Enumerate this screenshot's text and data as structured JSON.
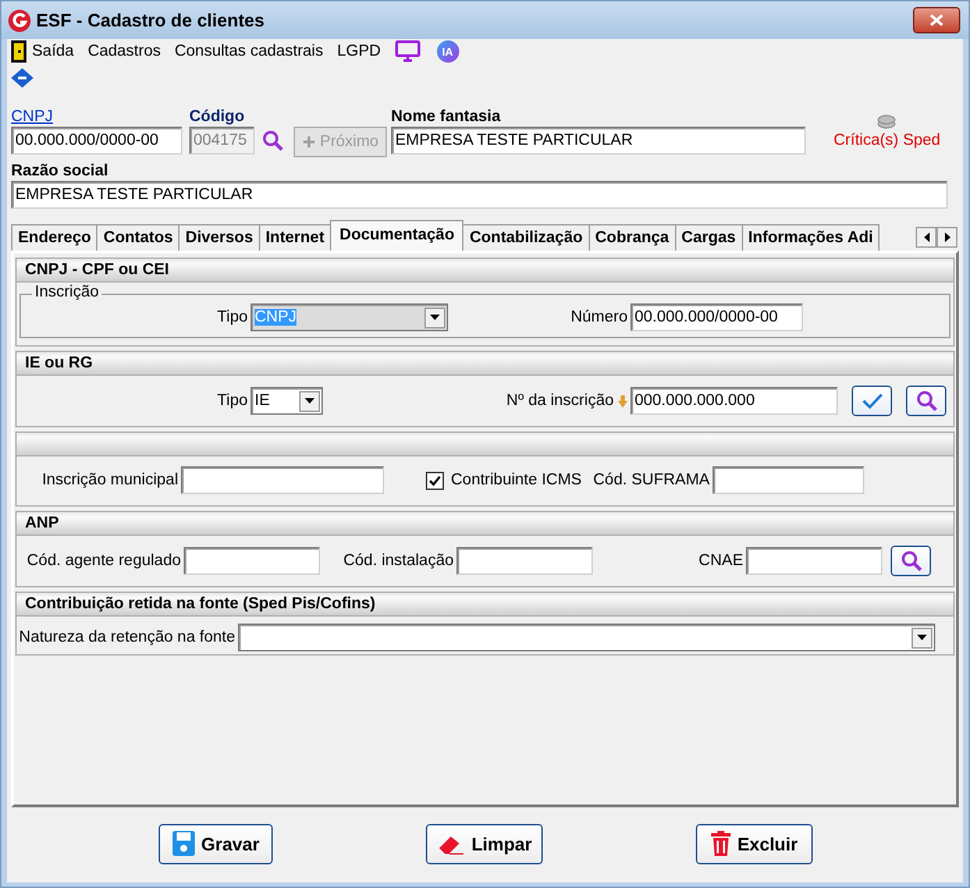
{
  "window": {
    "title": "ESF - Cadastro de clientes"
  },
  "menu": [
    {
      "label": "Saída",
      "kind": "exit"
    },
    {
      "label": "Cadastros",
      "kind": "text"
    },
    {
      "label": "Consultas cadastrais",
      "kind": "text"
    },
    {
      "label": "LGPD",
      "kind": "text"
    },
    {
      "kind": "monitor"
    },
    {
      "label": "IA",
      "kind": "badge"
    }
  ],
  "header": {
    "cnpj": {
      "label": "CNPJ",
      "value": "00.000.000/0000-00"
    },
    "codigo": {
      "label": "Código",
      "value": "004175",
      "disabled": true
    },
    "next_button": {
      "label": "Próximo",
      "disabled": true
    },
    "nome_fantasia": {
      "label": "Nome fantasia",
      "value": "EMPRESA TESTE PARTICULAR"
    },
    "sped": {
      "label": "Crítica(s) Sped"
    },
    "razao_social": {
      "label": "Razão social",
      "value": "EMPRESA TESTE PARTICULAR"
    }
  },
  "tabs": [
    {
      "label": "Endereço",
      "selected": false
    },
    {
      "label": "Contatos",
      "selected": false
    },
    {
      "label": "Diversos",
      "selected": false
    },
    {
      "label": "Internet",
      "selected": false
    },
    {
      "label": "Documentação",
      "selected": true
    },
    {
      "label": "Contabilização",
      "selected": false
    },
    {
      "label": "Cobrança",
      "selected": false
    },
    {
      "label": "Cargas",
      "selected": false
    },
    {
      "label": "Informações Adi",
      "selected": false
    }
  ],
  "sections": [
    {
      "title": "CNPJ - CPF ou CEI",
      "group": "Inscrição",
      "items": [
        {
          "kind": "select",
          "label": "Tipo",
          "value": "CNPJ",
          "focused": true
        },
        {
          "kind": "input",
          "label": "Número",
          "value": "00.000.000/0000-00"
        }
      ]
    },
    {
      "title": "IE ou RG",
      "items": [
        {
          "kind": "select",
          "label": "Tipo",
          "value": "IE",
          "focused": false
        },
        {
          "kind": "input",
          "label": "Nº da inscrição",
          "value": "000.000.000.000",
          "hint_arrow": true
        },
        {
          "kind": "confirm_button"
        },
        {
          "kind": "search_button"
        }
      ]
    },
    {
      "items": [
        {
          "kind": "input",
          "label": "Inscrição municipal"
        },
        {
          "kind": "checkbox",
          "label": "Contribuinte ICMS",
          "checked": true
        },
        {
          "kind": "input",
          "label": "Cód. SUFRAMA"
        }
      ]
    },
    {
      "title": "ANP",
      "items": [
        {
          "kind": "input",
          "label": "Cód. agente regulado"
        },
        {
          "kind": "input",
          "label": "Cód. instalação"
        },
        {
          "kind": "input",
          "label": "CNAE"
        },
        {
          "kind": "search_button"
        }
      ]
    },
    {
      "title": "Contribuição retida na fonte  (Sped Pis/Cofins)",
      "items": [
        {
          "kind": "select",
          "label": "Natureza da retenção na fonte",
          "focused": false
        }
      ]
    }
  ],
  "actions": [
    {
      "label": "Gravar"
    },
    {
      "label": "Limpar"
    },
    {
      "label": "Excluir"
    }
  ]
}
